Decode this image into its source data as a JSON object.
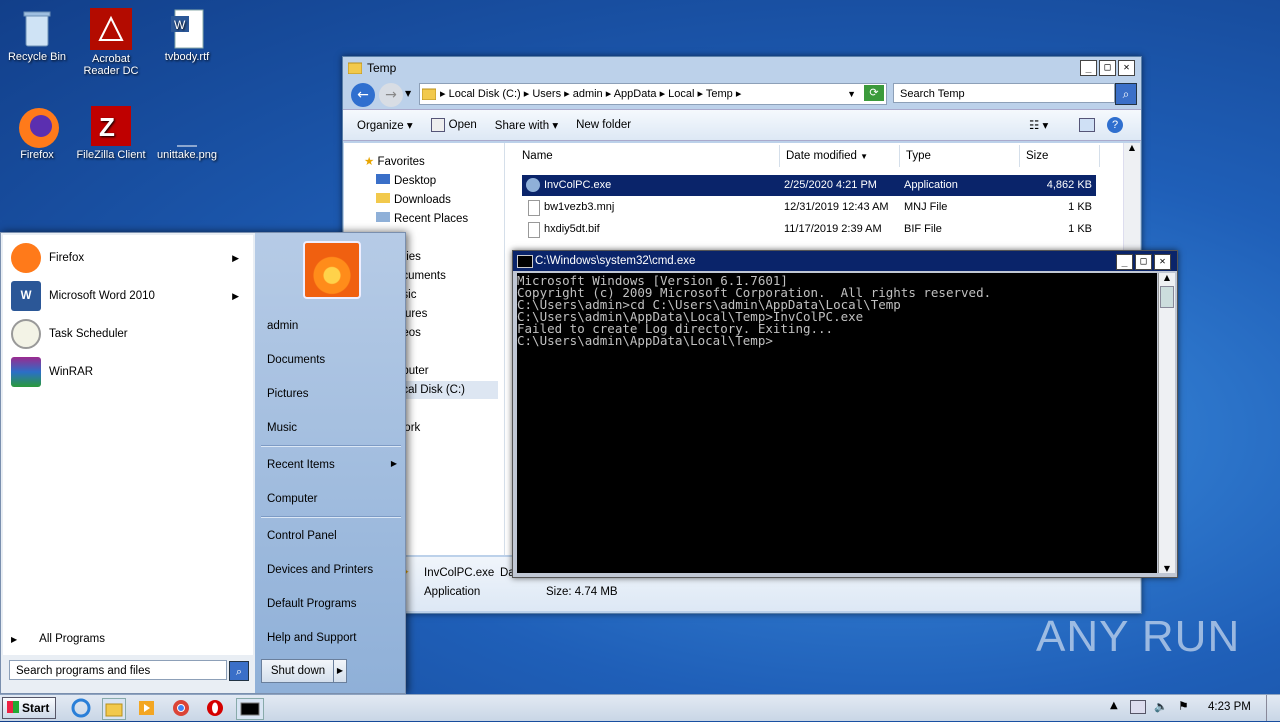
{
  "desktop": {
    "icons": [
      {
        "label": "Recycle Bin",
        "icon": "recycle-bin-icon"
      },
      {
        "label": "Acrobat Reader DC",
        "icon": "acrobat-icon"
      },
      {
        "label": "tvbody.rtf",
        "icon": "word-document-icon"
      },
      {
        "label": "Firefox",
        "icon": "firefox-icon"
      },
      {
        "label": "FileZilla Client",
        "icon": "filezilla-icon"
      },
      {
        "label": "unittake.png",
        "icon": "image-file-icon"
      }
    ]
  },
  "explorer": {
    "title": "Temp",
    "breadcrumb": [
      "Local Disk (C:)",
      "Users",
      "admin",
      "AppData",
      "Local",
      "Temp"
    ],
    "search_placeholder": "Search Temp",
    "toolbar": {
      "organize": "Organize",
      "open": "Open",
      "share_with": "Share with",
      "new_folder": "New folder"
    },
    "nav": {
      "favorites": "Favorites",
      "items": [
        "Desktop",
        "Downloads",
        "Recent Places"
      ],
      "partial": [
        "aries",
        "ocuments",
        "usic",
        "ctures",
        "deos",
        "nputer",
        "ocal Disk (C:)",
        "work"
      ]
    },
    "columns": {
      "name": "Name",
      "date_modified": "Date modified",
      "type": "Type",
      "size": "Size"
    },
    "files": [
      {
        "name": "InvColPC.exe",
        "date": "2/25/2020 4:21 PM",
        "type": "Application",
        "size": "4,862 KB"
      },
      {
        "name": "bw1vezb3.mnj",
        "date": "12/31/2019 12:43 AM",
        "type": "MNJ File",
        "size": "1 KB"
      },
      {
        "name": "hxdiy5dt.bif",
        "date": "11/17/2019 2:39 AM",
        "type": "BIF File",
        "size": "1 KB"
      }
    ],
    "details": {
      "name": "InvColPC.exe",
      "name_suffix": "Da",
      "type": "Application",
      "size_label": "Size: 4.74 MB"
    }
  },
  "cmd": {
    "title": "C:\\Windows\\system32\\cmd.exe",
    "lines": [
      "Microsoft Windows [Version 6.1.7601]",
      "Copyright (c) 2009 Microsoft Corporation.  All rights reserved.",
      "",
      "C:\\Users\\admin>cd C:\\Users\\admin\\AppData\\Local\\Temp",
      "",
      "C:\\Users\\admin\\AppData\\Local\\Temp>InvColPC.exe",
      "Failed to create Log directory. Exiting...",
      "C:\\Users\\admin\\AppData\\Local\\Temp>"
    ]
  },
  "start_menu": {
    "pinned": [
      "Firefox",
      "Microsoft Word 2010",
      "Task Scheduler",
      "WinRAR"
    ],
    "all_programs": "All Programs",
    "search_placeholder": "Search programs and files",
    "right": {
      "admin": "admin",
      "documents": "Documents",
      "pictures": "Pictures",
      "music": "Music",
      "recent_items": "Recent Items",
      "computer": "Computer",
      "control_panel": "Control Panel",
      "devices_printers": "Devices and Printers",
      "default_programs": "Default Programs",
      "help_support": "Help and Support"
    },
    "shutdown": "Shut down"
  },
  "taskbar": {
    "start": "Start",
    "clock": "4:23 PM"
  },
  "watermark": "ANY RUN",
  "colors": {
    "selection": "#0a246a",
    "desktop": "#1f5fb8"
  }
}
